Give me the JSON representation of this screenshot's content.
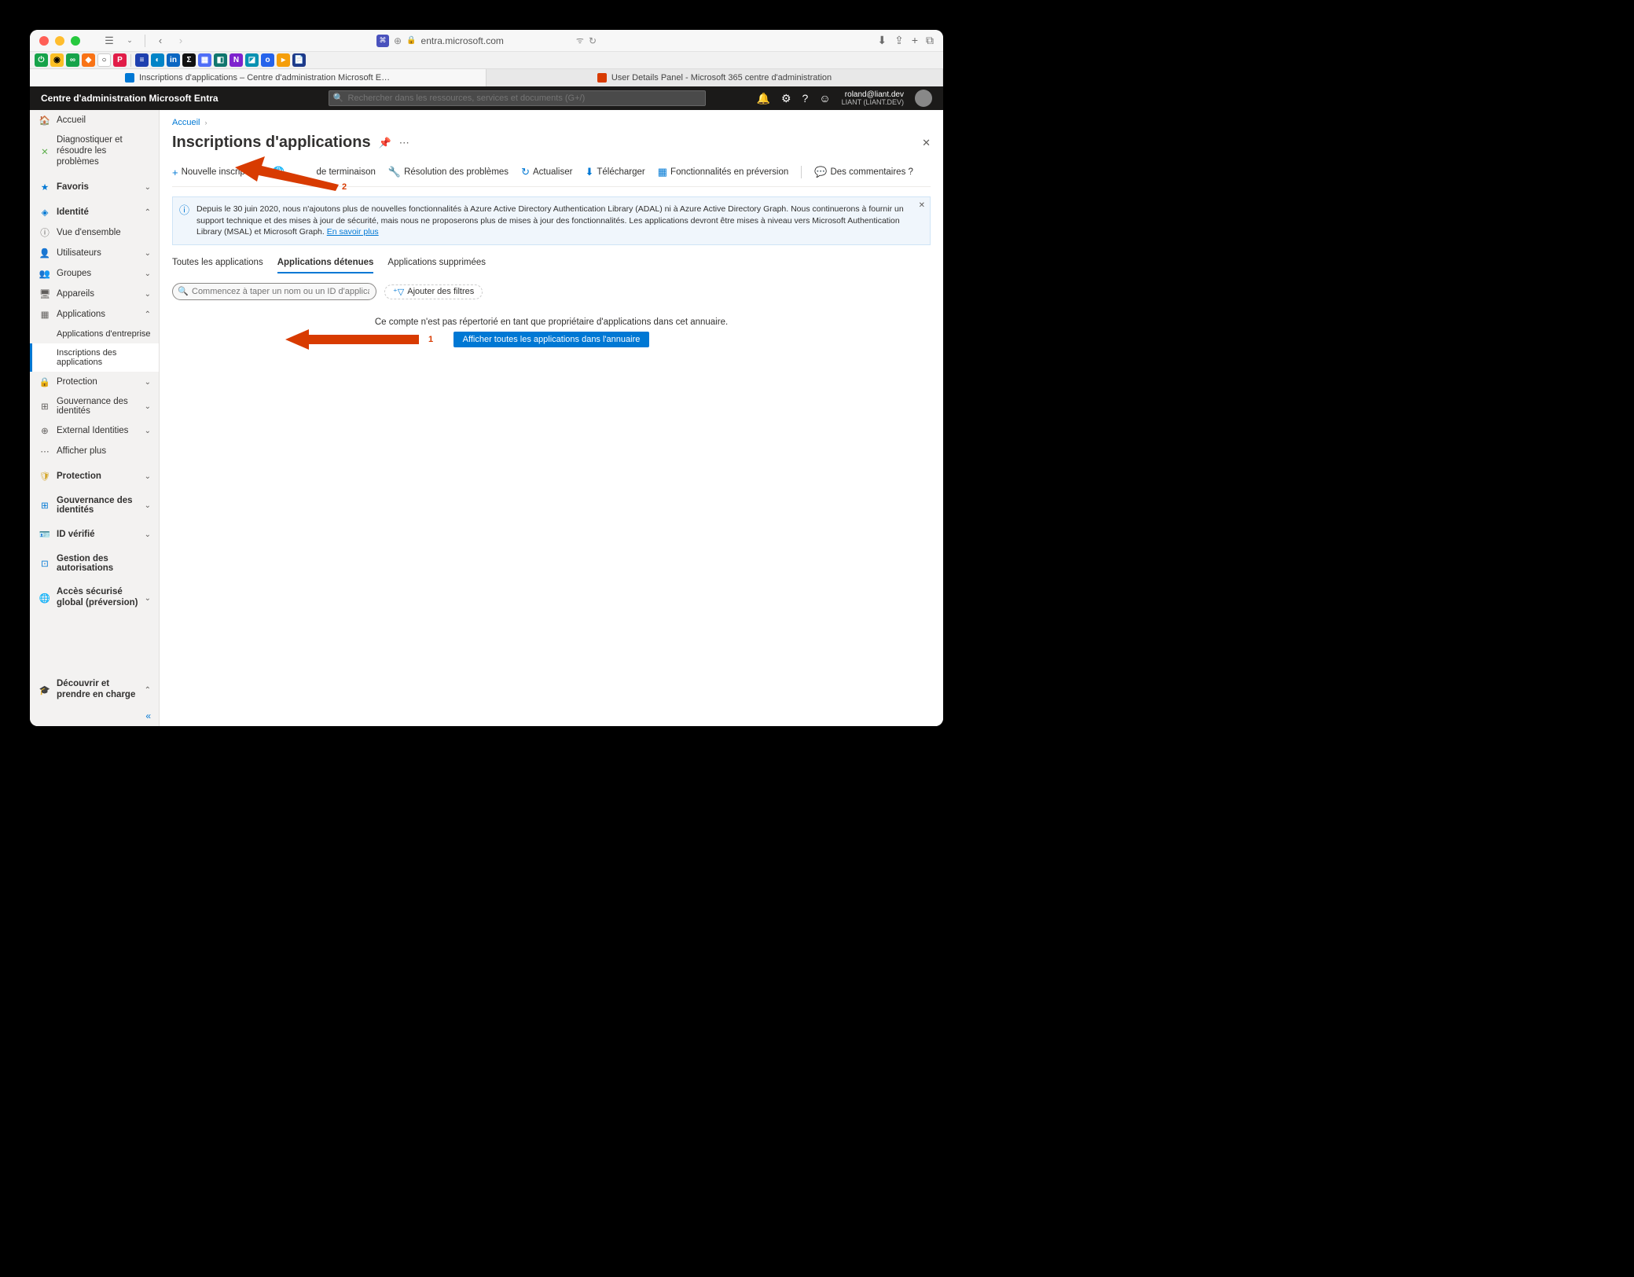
{
  "browser": {
    "url": "entra.microsoft.com",
    "tabs": [
      {
        "label": "Inscriptions d'applications – Centre d'administration Microsoft Entra",
        "active": true
      },
      {
        "label": "User Details Panel - Microsoft 365 centre d'administration",
        "active": false
      }
    ]
  },
  "portal": {
    "title": "Centre d'administration Microsoft Entra",
    "search_placeholder": "Rechercher dans les ressources, services et documents (G+/)",
    "user": {
      "email": "roland@liant.dev",
      "tenant": "LIANT (LIANT.DEV)"
    }
  },
  "sidebar": {
    "home": "Accueil",
    "diagnose": "Diagnostiquer et résoudre les problèmes",
    "favorites": "Favoris",
    "identity": "Identité",
    "overview": "Vue d'ensemble",
    "users": "Utilisateurs",
    "groups": "Groupes",
    "devices": "Appareils",
    "applications": "Applications",
    "enterprise_apps": "Applications d'entreprise",
    "app_registrations": "Inscriptions des applications",
    "protection": "Protection",
    "id_governance": "Gouvernance des identités",
    "external_ids": "External Identities",
    "show_more": "Afficher plus",
    "protection2": "Protection",
    "id_governance2": "Gouvernance des identités",
    "verified_id": "ID vérifié",
    "permissions_mgmt": "Gestion des autorisations",
    "global_secure": "Accès sécurisé global (préversion)",
    "learn": "Découvrir et prendre en charge"
  },
  "main": {
    "breadcrumb": {
      "home": "Accueil"
    },
    "title": "Inscriptions d'applications",
    "toolbar": {
      "new_registration": "Nouvelle inscription",
      "endpoints": "de terminaison",
      "troubleshoot": "Résolution des problèmes",
      "refresh": "Actualiser",
      "download": "Télécharger",
      "preview_features": "Fonctionnalités en préversion",
      "feedback": "Des commentaires ?"
    },
    "banner": {
      "text": "Depuis le 30 juin 2020, nous n'ajoutons plus de nouvelles fonctionnalités à Azure Active Directory Authentication Library (ADAL) ni à Azure Active Directory Graph. Nous continuerons à fournir un support technique et des mises à jour de sécurité, mais nous ne proposerons plus de mises à jour des fonctionnalités. Les applications devront être mises à niveau vers Microsoft Authentication Library (MSAL) et Microsoft Graph.",
      "link": "En savoir plus"
    },
    "subtabs": {
      "all": "Toutes les applications",
      "owned": "Applications détenues",
      "deleted": "Applications supprimées"
    },
    "filter": {
      "placeholder": "Commencez à taper un nom ou un ID d'application (client) pour filtr...",
      "add": "Ajouter des filtres"
    },
    "empty": {
      "text": "Ce compte n'est pas répertorié en tant que propriétaire d'applications dans cet annuaire.",
      "button": "Afficher toutes les applications dans l'annuaire"
    }
  },
  "arrows": {
    "one": "1",
    "two": "2"
  }
}
